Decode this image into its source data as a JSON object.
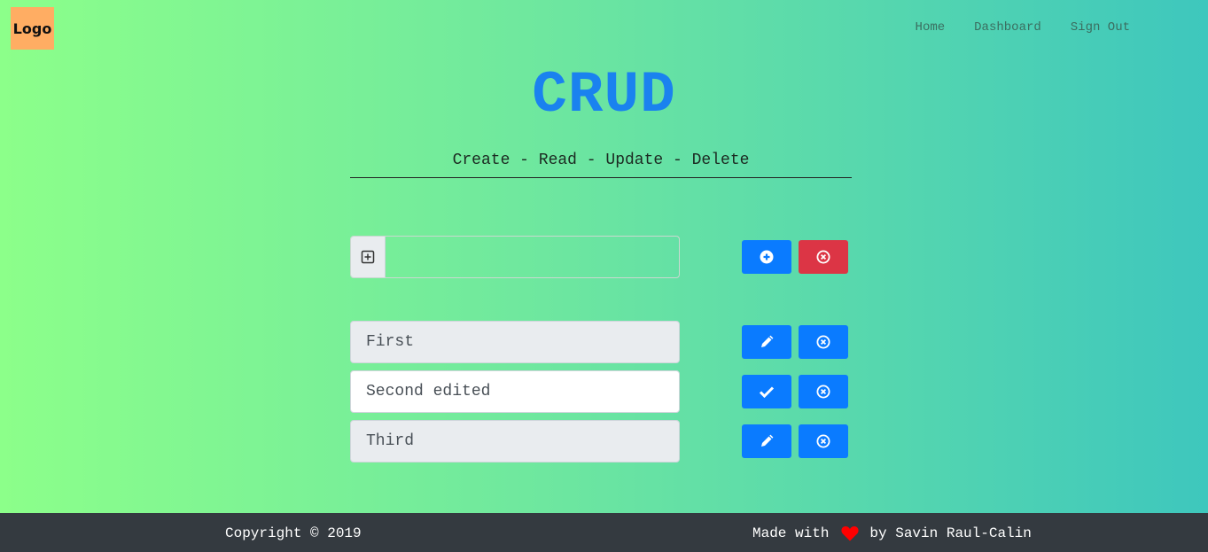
{
  "header": {
    "logo": "Logo",
    "nav": [
      "Home",
      "Dashboard",
      "Sign Out"
    ]
  },
  "hero": {
    "title": "CRUD",
    "subtitle": "Create - Read - Update - Delete"
  },
  "new_item": {
    "value": "",
    "icons": {
      "prepend": "plus-square-icon",
      "add": "plus-circle-icon",
      "clear": "times-circle-icon"
    }
  },
  "items": [
    {
      "value": "First",
      "mode": "view",
      "action_icon": "pencil-icon",
      "delete_icon": "times-circle-icon"
    },
    {
      "value": "Second edited",
      "mode": "edit",
      "action_icon": "check-icon",
      "delete_icon": "times-circle-icon"
    },
    {
      "value": "Third",
      "mode": "view",
      "action_icon": "pencil-icon",
      "delete_icon": "times-circle-icon"
    }
  ],
  "footer": {
    "copyright": "Copyright © 2019",
    "made_with": "Made with",
    "by": "by Savin Raul-Calin"
  },
  "colors": {
    "primary": "#0a7bff",
    "danger": "#dc3545",
    "title": "#1a82ef",
    "footer_bg": "#343a40",
    "logo_bg": "#ffad63",
    "heart": "#ff0000"
  }
}
